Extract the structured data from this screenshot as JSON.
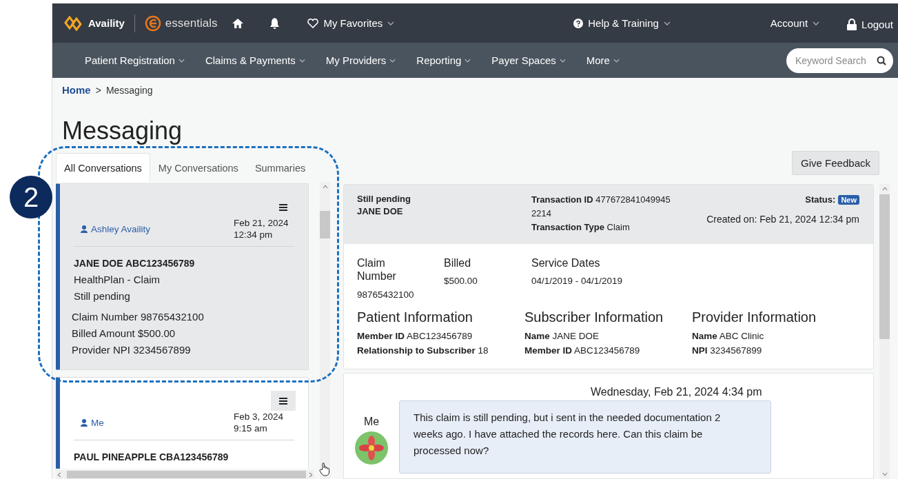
{
  "header": {
    "brand": "Availity",
    "product": "essentials",
    "favorites": "My Favorites",
    "help": "Help & Training",
    "account": "Account",
    "logout": "Logout"
  },
  "nav": {
    "items": [
      "Patient Registration",
      "Claims & Payments",
      "My Providers",
      "Reporting",
      "Payer Spaces",
      "More"
    ],
    "search": {
      "placeholder": "Keyword Search"
    }
  },
  "breadcrumb": {
    "home": "Home",
    "separator": ">",
    "current": "Messaging"
  },
  "page_title": "Messaging",
  "annotation": {
    "badge": "2"
  },
  "tabs": [
    {
      "label": "All Conversations",
      "selected": true
    },
    {
      "label": "My Conversations",
      "selected": false
    },
    {
      "label": "Summaries",
      "selected": false
    }
  ],
  "feedback_button": "Give Feedback",
  "conversations": [
    {
      "author": "Ashley Availity",
      "date": "Feb 21, 2024",
      "time": "12:34 pm",
      "title": "JANE DOE ABC123456789",
      "lines": [
        "HealthPlan - Claim",
        "Still pending"
      ],
      "details": [
        "Claim Number 98765432100",
        "Billed Amount $500.00",
        "Provider NPI 3234567899"
      ],
      "selected": true
    },
    {
      "author": "Me",
      "date": "Feb 3, 2024",
      "time": "9:15 am",
      "title": "PAUL PINEAPPLE CBA123456789",
      "selected": false
    }
  ],
  "detail": {
    "status_text": "Still pending",
    "patient": "JANE DOE",
    "transaction": [
      "**Transaction ID** 477672841049945 2214",
      "**Transaction Type** Claim"
    ],
    "status_label": "Status:",
    "status_badge": "New",
    "created": "Created on: Feb 21, 2024 12:34 pm",
    "summary": [
      {
        "label": "Claim Number",
        "value": "98765432100"
      },
      {
        "label": "Billed",
        "value": "$500.00"
      },
      {
        "label": "Service Dates",
        "value": "04/1/2019 - 04/1/2019"
      }
    ],
    "sections": [
      {
        "title": "Patient Information",
        "fields": [
          "**Member ID** ABC123456789",
          "**Relationship to Subscriber** 18"
        ]
      },
      {
        "title": "Subscriber Information",
        "fields": [
          "**Name** JANE DOE",
          "**Member ID** ABC123456789"
        ]
      },
      {
        "title": "Provider Information",
        "fields": [
          "**Name** ABC Clinic",
          "**NPI** 3234567899"
        ]
      }
    ]
  },
  "messages": [
    {
      "timestamp": "Wednesday, Feb 21, 2024 4:34 pm",
      "sender": "Me",
      "text": "This claim is still pending, but i sent in the needed documentation 2 weeks ago. I have attached the records here. Can this claim be processed now?"
    }
  ]
}
